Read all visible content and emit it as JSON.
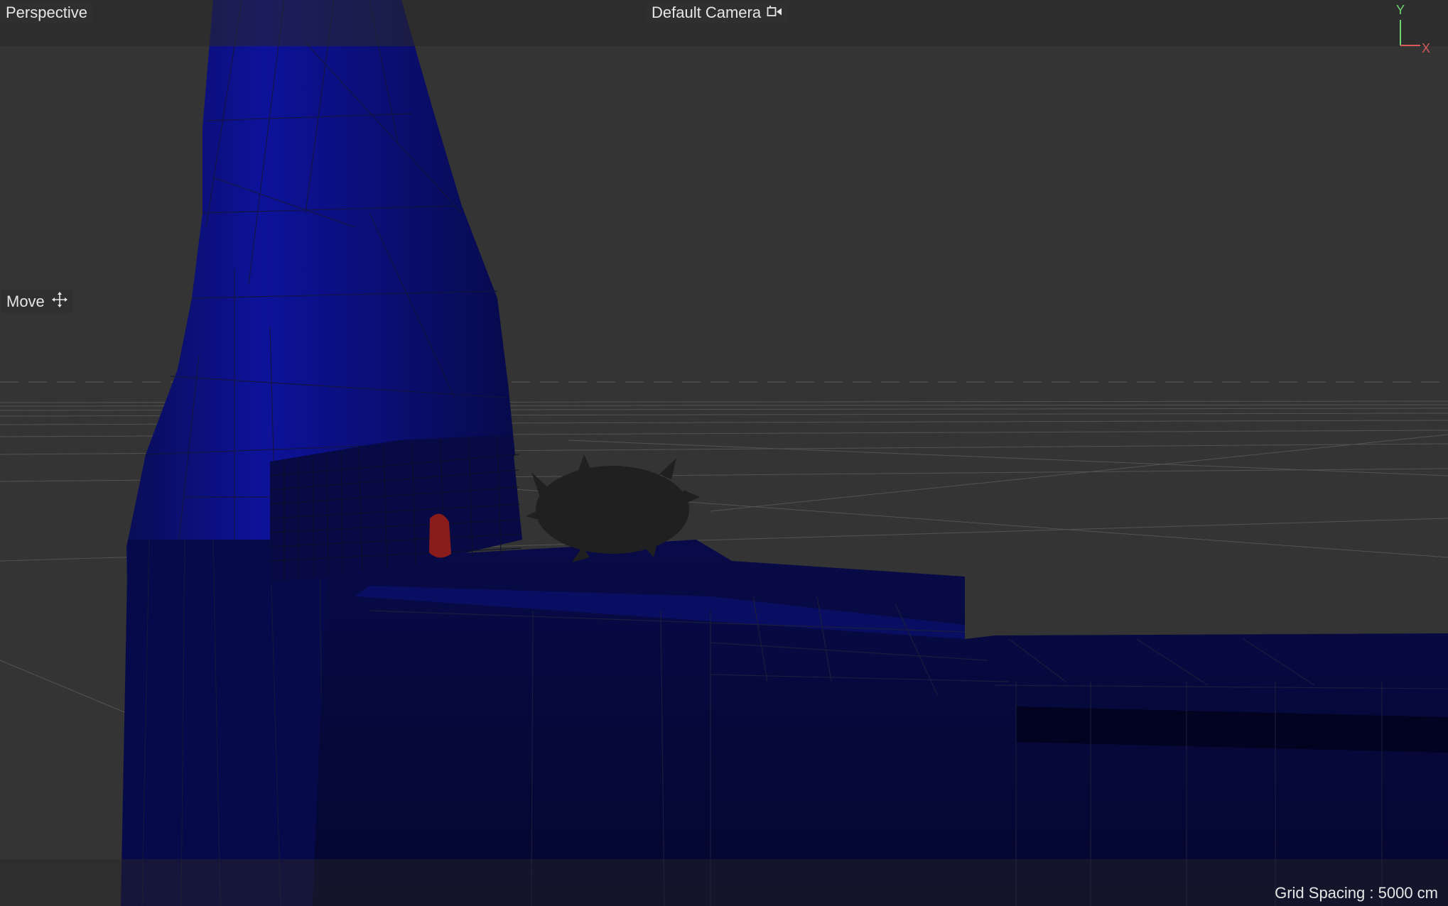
{
  "viewport": {
    "view_mode_label": "Perspective",
    "camera_label": "Default Camera",
    "active_tool_label": "Move",
    "grid_spacing_text": "Grid Spacing : 5000 cm"
  },
  "axis_gizmo": {
    "y_label": "Y",
    "x_label": "X",
    "y_color": "#6fd46f",
    "x_color": "#d85a5a"
  },
  "icons": {
    "camera": "camera-icon",
    "move": "move-crosshair-icon"
  },
  "colors": {
    "background": "#343434",
    "model_blue": "#0b0f5c",
    "wire": "#1a1a2a",
    "accent_red": "#8a1c1c"
  }
}
